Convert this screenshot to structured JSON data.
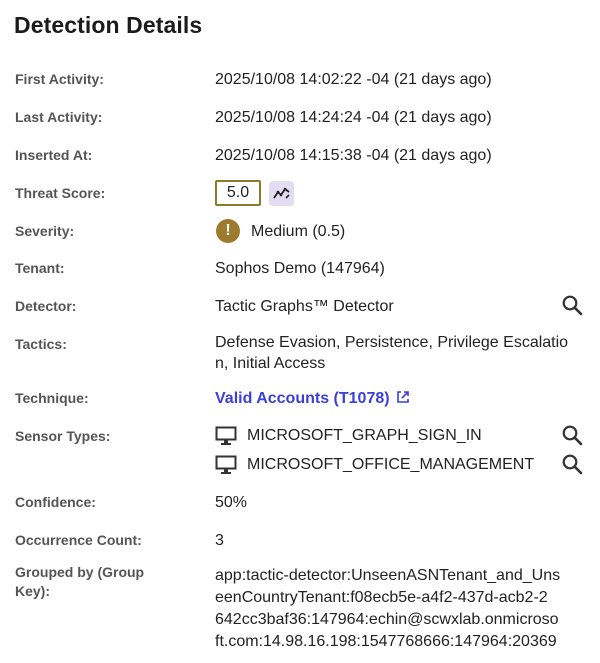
{
  "title": "Detection Details",
  "fields": {
    "first_activity": {
      "label": "First Activity:",
      "value": "2025/10/08 14:02:22 -04 (21 days ago)"
    },
    "last_activity": {
      "label": "Last Activity:",
      "value": "2025/10/08 14:24:24 -04 (21 days ago)"
    },
    "inserted_at": {
      "label": "Inserted At:",
      "value": "2025/10/08 14:15:38 -04 (21 days ago)"
    },
    "threat_score": {
      "label": "Threat Score:",
      "value": "5.0",
      "icon": "trend-chart-icon"
    },
    "severity": {
      "label": "Severity:",
      "value": "Medium (0.5)",
      "icon": "exclamation-icon",
      "icon_glyph": "!",
      "color": "#9d7a2e"
    },
    "tenant": {
      "label": "Tenant:",
      "value": "Sophos Demo (147964)"
    },
    "detector": {
      "label": "Detector:",
      "value": "Tactic Graphs™ Detector"
    },
    "tactics": {
      "label": "Tactics:",
      "line1": "Defense Evasion, Persistence, Privilege Escalatio",
      "line2": "n, Initial Access"
    },
    "technique": {
      "label": "Technique:",
      "value": "Valid Accounts (T1078)",
      "color": "#3b3fd8"
    },
    "sensor_types": {
      "label": "Sensor Types:",
      "items": [
        "MICROSOFT_GRAPH_SIGN_IN",
        "MICROSOFT_OFFICE_MANAGEMENT"
      ]
    },
    "confidence": {
      "label": "Confidence:",
      "value": "50%"
    },
    "occurrence_count": {
      "label": "Occurrence Count:",
      "value": "3"
    },
    "grouped_by": {
      "label_line1": "Grouped by (Group",
      "label_line2": "Key):",
      "lines": [
        "app:tactic-detector:UnseenASNTenant_and_Uns",
        "eenCountryTenant:f08ecb5e-a4f2-437d-acb2-2",
        "642cc3baf36:147964:echin@scwxlab.onmicroso",
        "ft.com:14.98.16.198:1547768666:147964:20369"
      ]
    }
  }
}
